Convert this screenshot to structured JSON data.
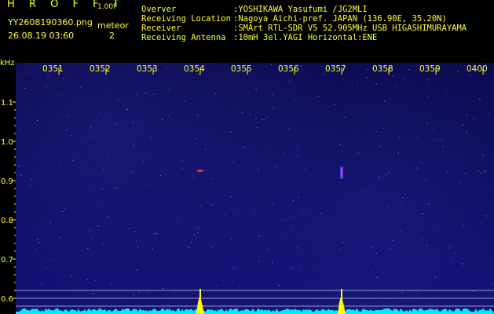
{
  "header": {
    "title": "H R O F F T",
    "version": "1.00f",
    "filename": "YY2608190360.png",
    "datetime": "26.08.19 03:60",
    "meteor_label": "meteor",
    "meteor_count": "2",
    "info": [
      {
        "label": "Overver",
        "value": ":YOSHIKAWA Yasufumi /JG2MLI"
      },
      {
        "label": "Receiving Location",
        "value": ":Nagoya Aichi-pref. JAPAN (136.90E, 35.20N)"
      },
      {
        "label": "Receiver",
        "value": ":SMArt RTL-SDR V5 52.905MHz USB HIGASHIMURAYAMA"
      },
      {
        "label": "Receiving Antenna",
        "value": ":10mH 3el.YAGI Horizontal:ENE"
      }
    ]
  },
  "spectrogram": {
    "y_unit": "kHz",
    "y_ticks": [
      {
        "label": "1.1",
        "value": 1.1
      },
      {
        "label": "1.0",
        "value": 1.0
      },
      {
        "label": "0.9",
        "value": 0.9
      },
      {
        "label": "0.8",
        "value": 0.8
      },
      {
        "label": "0.7",
        "value": 0.7
      },
      {
        "label": "0.6",
        "value": 0.6
      }
    ],
    "x_ticks": [
      "0351",
      "0352",
      "0353",
      "0354",
      "0355",
      "0356",
      "0357",
      "0358",
      "0359",
      "0400"
    ],
    "y_range": [
      0.58,
      1.19
    ],
    "events": [
      {
        "minute": 4.0,
        "freq": 0.925,
        "span": 0.006
      },
      {
        "minute": 7.0,
        "freq": 0.92,
        "span": 0.03
      }
    ],
    "colors": {
      "tick": "#ffff30",
      "signal_peak": "#ffff00",
      "noise_floor": "#00e8ff",
      "meteor": "#ff3030",
      "guide": "#c8c8c8"
    }
  }
}
